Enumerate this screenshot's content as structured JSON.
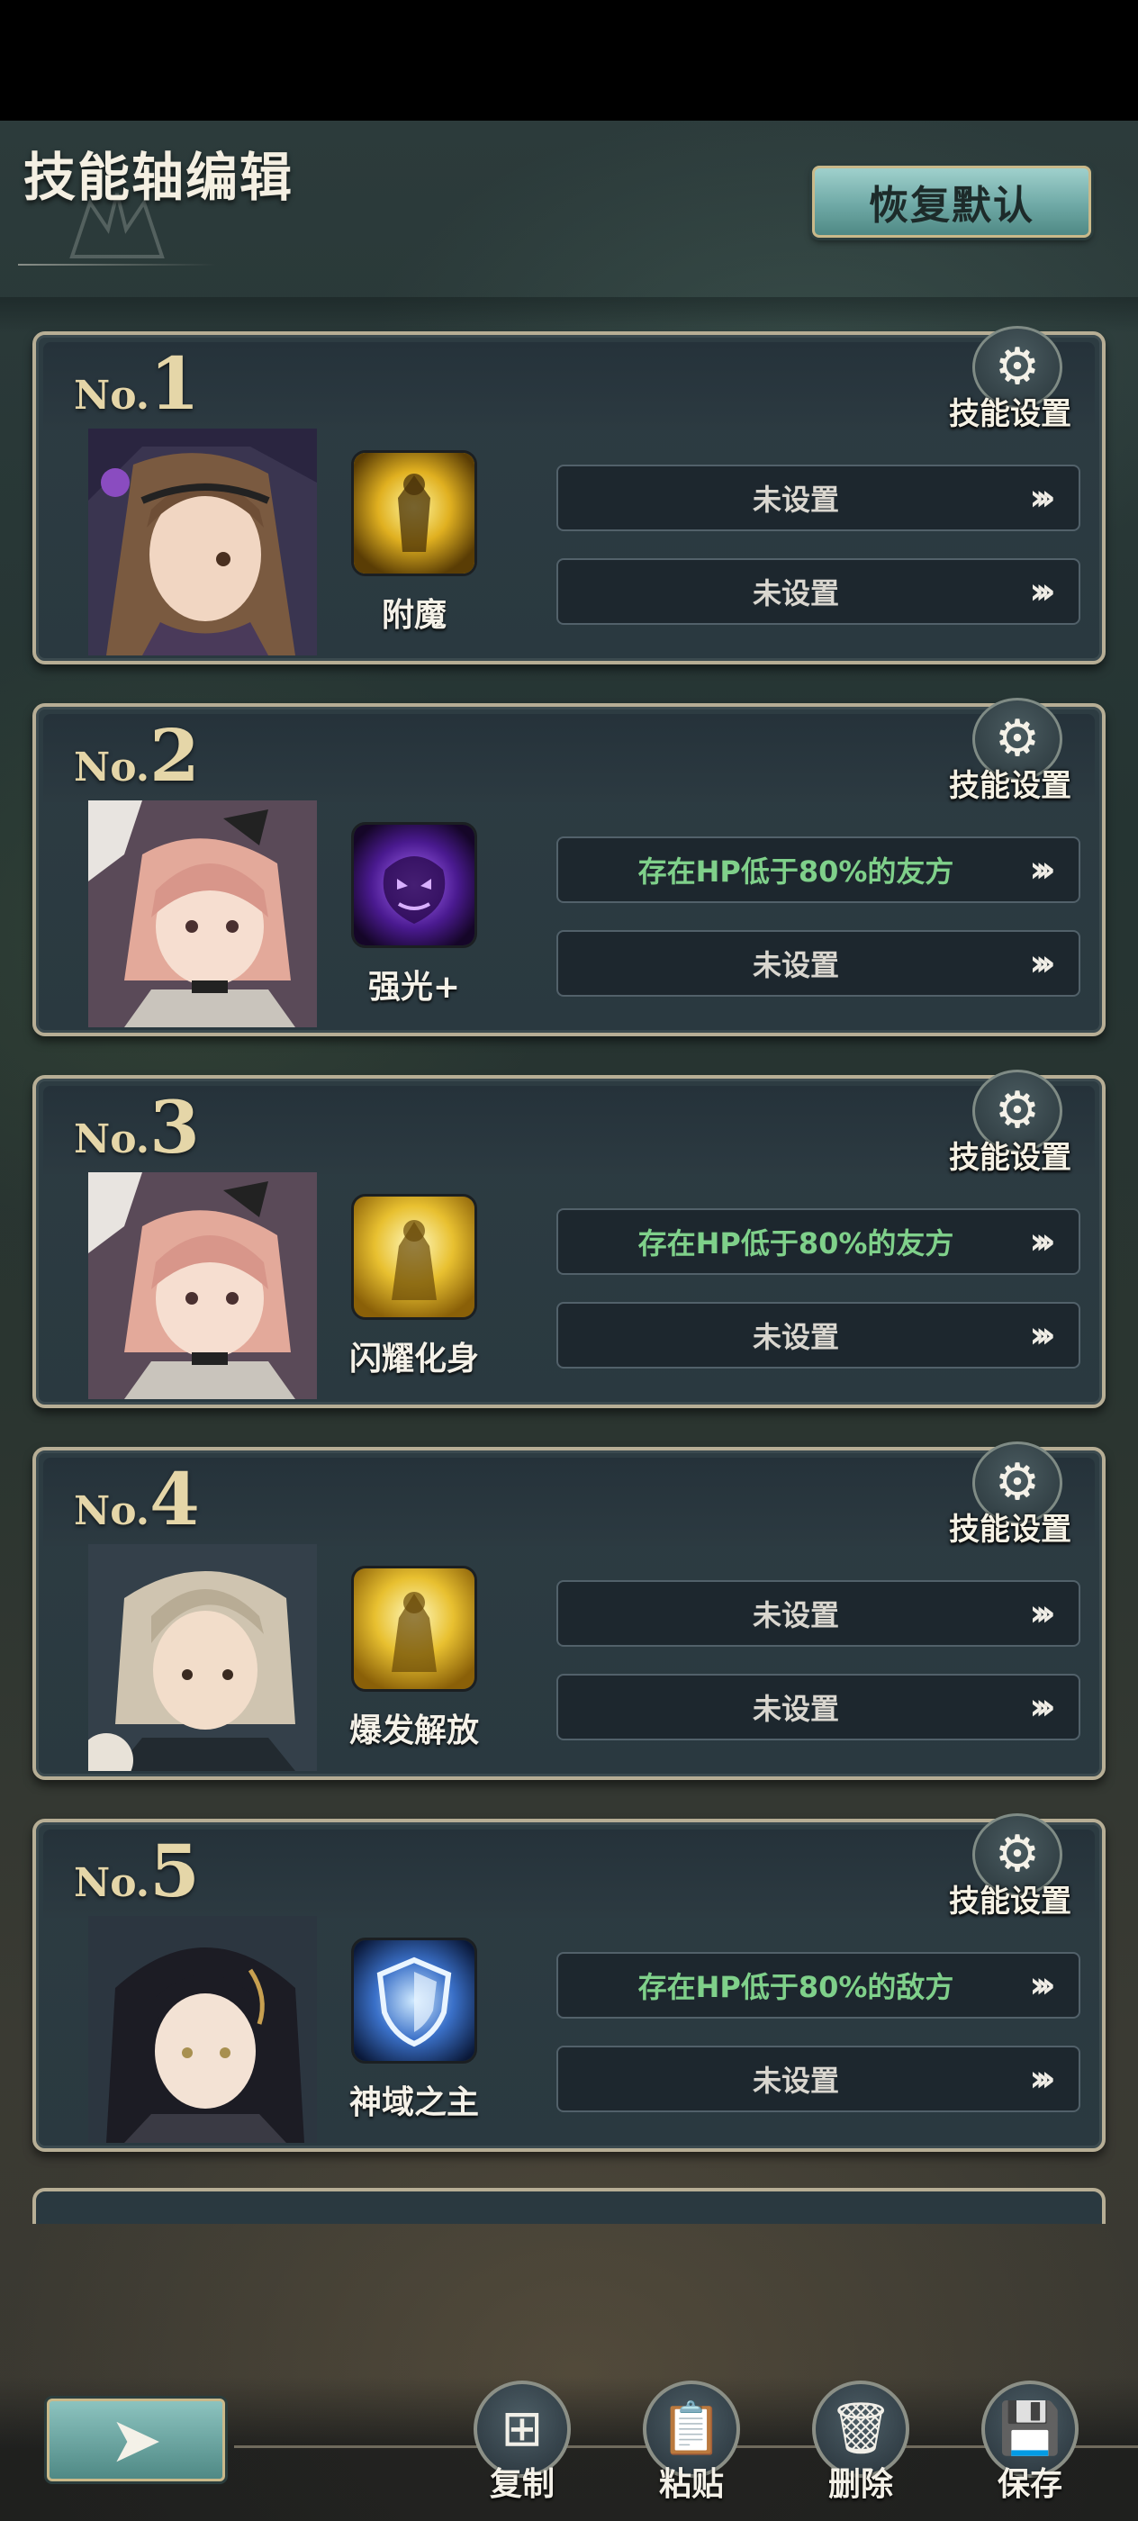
{
  "header": {
    "title": "技能轴编辑",
    "reset_button": "恢复默认"
  },
  "cards": [
    {
      "no_prefix": "No.",
      "number": "1",
      "skill_setting": "技能设置",
      "skill_name": "附魔",
      "cond1": "未设置",
      "cond1_set": false,
      "cond2": "未设置",
      "cond2_set": false
    },
    {
      "no_prefix": "No.",
      "number": "2",
      "skill_setting": "技能设置",
      "skill_name": "强光+",
      "cond1": "存在HP低于80%的友方",
      "cond1_set": true,
      "cond2": "未设置",
      "cond2_set": false
    },
    {
      "no_prefix": "No.",
      "number": "3",
      "skill_setting": "技能设置",
      "skill_name": "闪耀化身",
      "cond1": "存在HP低于80%的友方",
      "cond1_set": true,
      "cond2": "未设置",
      "cond2_set": false
    },
    {
      "no_prefix": "No.",
      "number": "4",
      "skill_setting": "技能设置",
      "skill_name": "爆发解放",
      "cond1": "未设置",
      "cond1_set": false,
      "cond2": "未设置",
      "cond2_set": false
    },
    {
      "no_prefix": "No.",
      "number": "5",
      "skill_setting": "技能设置",
      "skill_name": "神域之主",
      "cond1": "存在HP低于80%的敌方",
      "cond1_set": true,
      "cond2": "未设置",
      "cond2_set": false
    }
  ],
  "arrow_glyph": "›››",
  "toolbar": {
    "copy": "复制",
    "paste": "粘贴",
    "delete": "删除",
    "save": "保存"
  },
  "colors": {
    "condition_set": "#7fd08a",
    "condition_unset": "#d9d6cf",
    "frame_gold": "#b7ae95",
    "button_teal": "#6fa9a6"
  }
}
